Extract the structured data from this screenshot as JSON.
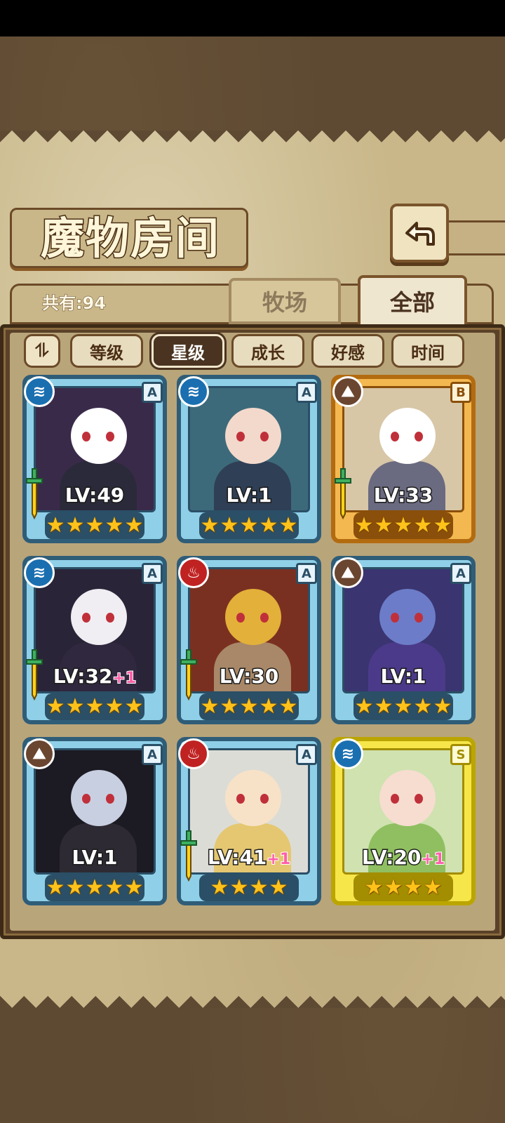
{
  "title": "魔物房间",
  "total": "共有:94",
  "tabs": {
    "ranch": "牧场",
    "all": "全部"
  },
  "sort": {
    "toggle": "⥮",
    "options": [
      "等级",
      "星级",
      "成长",
      "好感",
      "时间"
    ],
    "active": "星级"
  },
  "back_icon": "back-arrow-icon",
  "cards": [
    {
      "level": "LV:49",
      "bonus": "",
      "rank": "A",
      "element": "water",
      "stars": 5,
      "weapon": true,
      "frame": "blue"
    },
    {
      "level": "LV:1",
      "bonus": "",
      "rank": "A",
      "element": "water",
      "stars": 5,
      "weapon": false,
      "frame": "blue"
    },
    {
      "level": "LV:33",
      "bonus": "",
      "rank": "B",
      "element": "earth",
      "stars": 5,
      "weapon": true,
      "frame": "gold"
    },
    {
      "level": "LV:32",
      "bonus": "+1",
      "rank": "A",
      "element": "water",
      "stars": 5,
      "weapon": true,
      "frame": "blue"
    },
    {
      "level": "LV:30",
      "bonus": "",
      "rank": "A",
      "element": "fire",
      "stars": 5,
      "weapon": true,
      "frame": "blue"
    },
    {
      "level": "LV:1",
      "bonus": "",
      "rank": "A",
      "element": "earth",
      "stars": 5,
      "weapon": false,
      "frame": "blue"
    },
    {
      "level": "LV:1",
      "bonus": "",
      "rank": "A",
      "element": "earth",
      "stars": 5,
      "weapon": false,
      "frame": "blue"
    },
    {
      "level": "LV:41",
      "bonus": "+1",
      "rank": "A",
      "element": "fire",
      "stars": 4,
      "weapon": true,
      "frame": "blue"
    },
    {
      "level": "LV:20",
      "bonus": "+1",
      "rank": "S",
      "element": "water",
      "stars": 4,
      "weapon": false,
      "frame": "yellow"
    }
  ],
  "colors": {
    "water": "#1a6fb0",
    "fire": "#c02222",
    "earth": "#6a4630",
    "star": "#ffc21a"
  }
}
